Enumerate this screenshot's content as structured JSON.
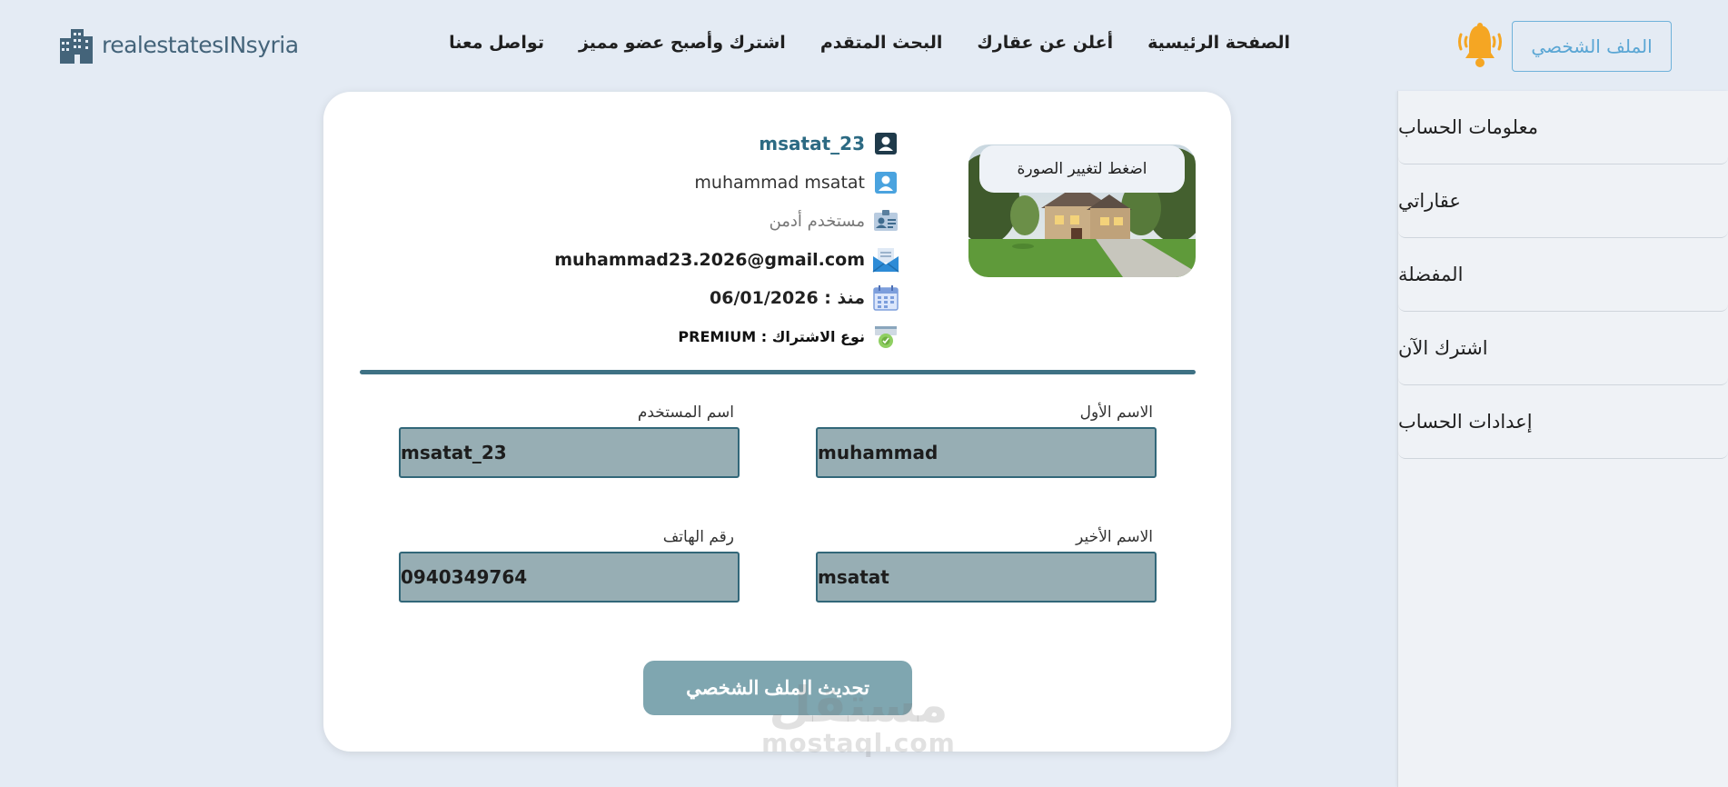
{
  "header": {
    "logo_text": "realestatesINsyria",
    "nav": [
      {
        "label": "الصفحة الرئيسية"
      },
      {
        "label": "أعلن عن عقارك"
      },
      {
        "label": "البحث المتقدم"
      },
      {
        "label": "اشترك وأصبح عضو مميز"
      },
      {
        "label": "تواصل معنا"
      }
    ],
    "profile_button": "الملف الشخصي"
  },
  "sidebar": {
    "items": [
      {
        "label": "معلومات الحساب"
      },
      {
        "label": "عقاراتي"
      },
      {
        "label": "المفضلة"
      },
      {
        "label": "اشترك الآن"
      },
      {
        "label": "إعدادات الحساب"
      }
    ]
  },
  "profile": {
    "change_photo_label": "اضغط لتغيير الصورة",
    "username": "msatat_23",
    "full_name": "muhammad msatat",
    "role": "مستخدم أدمن",
    "email": "muhammad23.2026@gmail.com",
    "since": "منذ : 06/01/2026",
    "subscription": "نوع الاشتراك : PREMIUM"
  },
  "form": {
    "first_name_label": "الاسم الأول",
    "first_name_value": "muhammad",
    "username_label": "اسم المستخدم",
    "username_value": "msatat_23",
    "last_name_label": "الاسم الأخير",
    "last_name_value": "msatat",
    "phone_label": "رقم الهاتف",
    "phone_value": "0940349764",
    "update_button": "تحديث الملف الشخصي"
  },
  "watermark": {
    "arabic": "مستقل",
    "latin": "mostaql.com"
  },
  "colors": {
    "accent": "#3e7184",
    "field_bg": "#97aeb4",
    "page_bg": "#e4ebf4",
    "bell": "#f5a623"
  },
  "icons": [
    "building-logo-icon",
    "bell-icon",
    "id-card-icon",
    "user-icon",
    "contact-card-icon",
    "envelope-icon",
    "calendar-icon",
    "badge-icon"
  ]
}
